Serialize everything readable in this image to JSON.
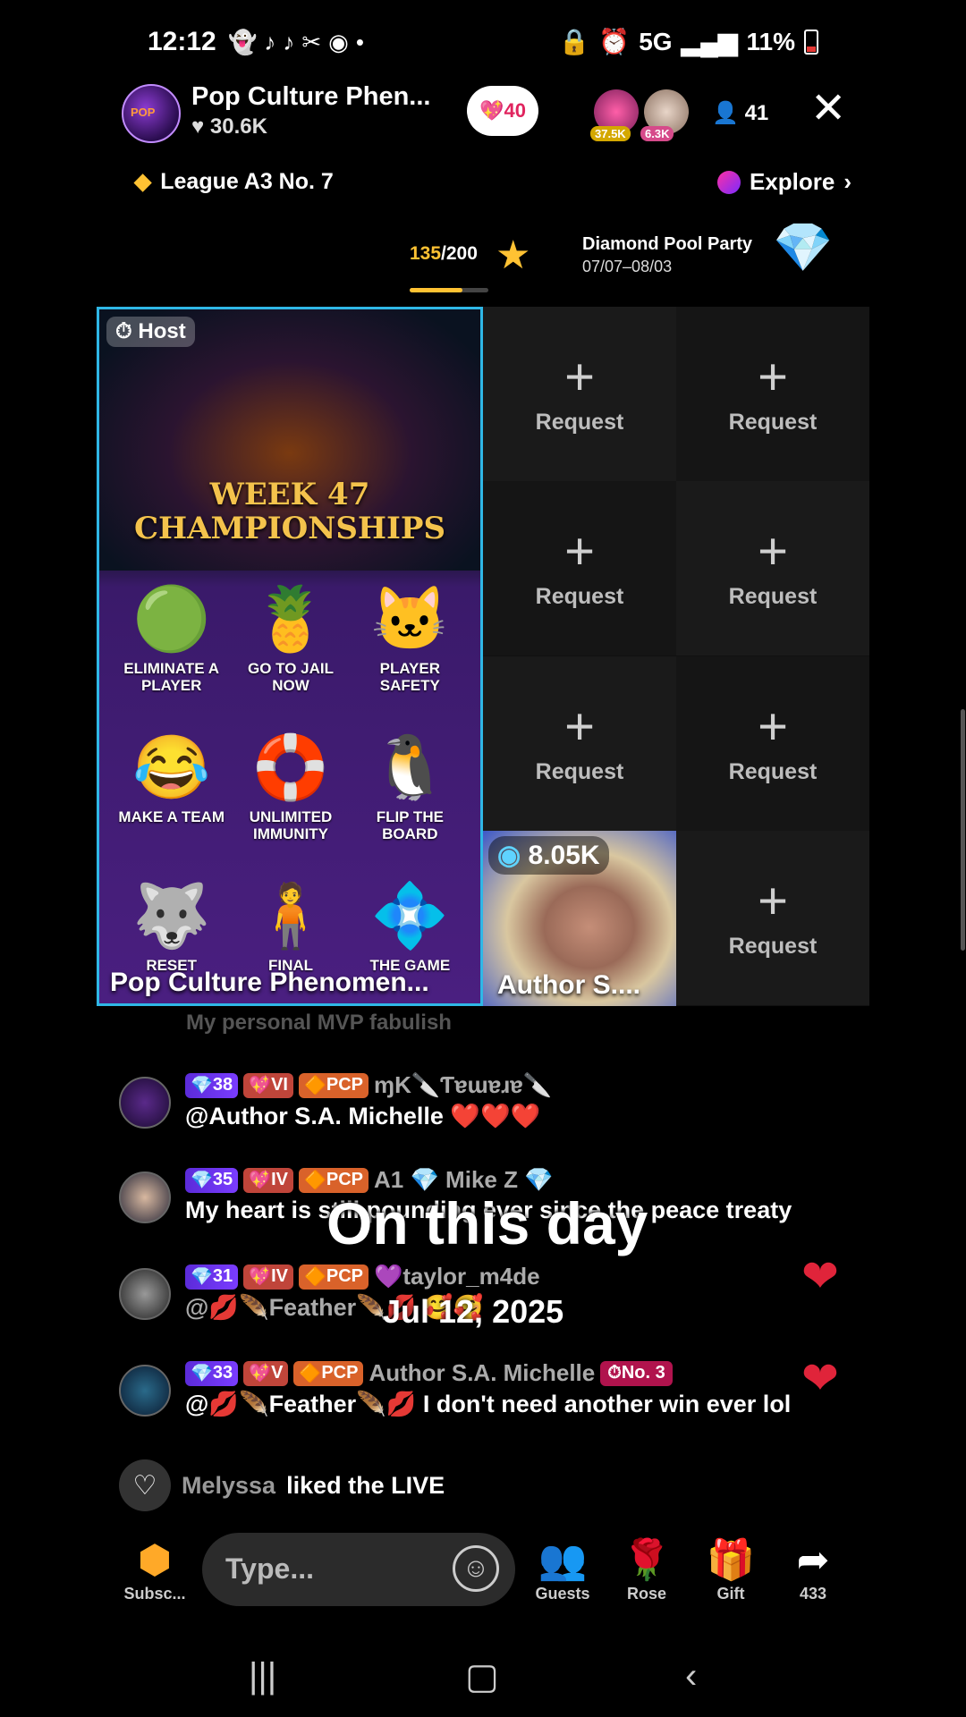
{
  "status_bar": {
    "time": "12:12",
    "network": "5G",
    "battery": "11%"
  },
  "header": {
    "host_name": "Pop Culture Phen...",
    "host_likes": "30.6K",
    "follow_count": "40",
    "viewer1_badge": "37.5K",
    "viewer2_badge": "6.3K",
    "viewer_count": "41"
  },
  "league": {
    "label": "League A3 No. 7",
    "explore_label": "Explore"
  },
  "progress": {
    "current": "135",
    "total": "/200",
    "fill_fraction": 0.675,
    "event_title": "Diamond Pool Party",
    "event_dates": "07/07–08/03"
  },
  "host_tile": {
    "tag": "Host",
    "banner_line1": "WEEK 47",
    "banner_line2": "CHAMPIONSHIPS",
    "cards": [
      {
        "label": "ELIMINATE A PLAYER",
        "icon": "green-jelly"
      },
      {
        "label": "GO TO JAIL NOW",
        "icon": "pineapple"
      },
      {
        "label": "PLAYER SAFETY",
        "icon": "cat-chair"
      },
      {
        "label": "MAKE A TEAM",
        "icon": "laughing-faces"
      },
      {
        "label": "UNLIMITED IMMUNITY",
        "icon": "float-ring"
      },
      {
        "label": "FLIP THE BOARD",
        "icon": "penguin"
      },
      {
        "label": "RESET",
        "icon": "wolf"
      },
      {
        "label": "FINAL",
        "icon": "figure"
      },
      {
        "label": "THE GAME",
        "icon": "crystals"
      }
    ],
    "name": "Pop Culture Phenomen..."
  },
  "request_label": "Request",
  "guest": {
    "score": "8.05K",
    "name": "Author S...."
  },
  "chat": {
    "faded_line": "My personal MVP  fabulish",
    "messages": [
      {
        "level": "38",
        "rank": "VI",
        "club": "PCP",
        "user": "ɱK🔪Ƭɐɯɐɹɐ🔪",
        "text": "@Author S.A. Michelle ❤️❤️❤️"
      },
      {
        "level": "35",
        "rank": "IV",
        "club": "PCP",
        "user": "A1  💎 Mike Z 💎",
        "text": "My heart is still pounding ever since the peace treaty"
      },
      {
        "level": "31",
        "rank": "IV",
        "club": "PCP",
        "user": "💜taylor_m4de",
        "text": "@💋🪶Feather🪶💋 🥰🥰"
      },
      {
        "level": "33",
        "rank": "V",
        "club": "PCP",
        "user": "Author S.A. Michelle",
        "sub": "No. 3",
        "text": "@💋🪶Feather🪶💋 I don't need another win ever lol"
      }
    ],
    "liked_user": "Melyssa",
    "liked_text": "liked the LIVE"
  },
  "overlay": {
    "title": "On this day",
    "date": "Jul 12, 2025"
  },
  "bottom_bar": {
    "subscribe": "Subsc...",
    "placeholder": "Type...",
    "guests": "Guests",
    "rose": "Rose",
    "gift": "Gift",
    "share_count": "433"
  },
  "colors": {
    "accent": "#ffc233",
    "host_border": "#2fb7e6",
    "like_red": "#e0243a"
  }
}
